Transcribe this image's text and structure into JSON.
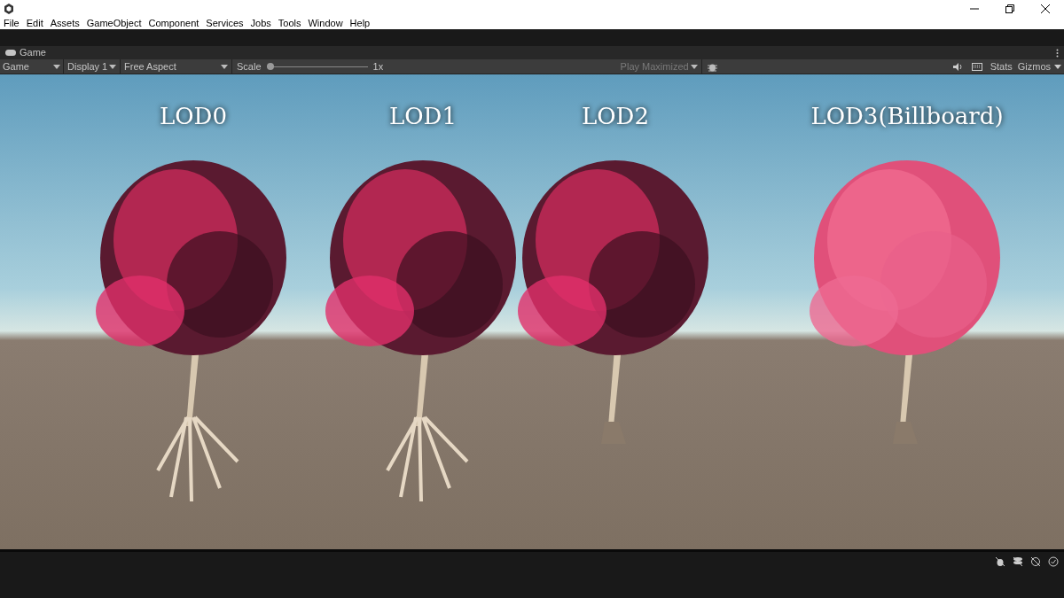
{
  "menu": [
    "File",
    "Edit",
    "Assets",
    "GameObject",
    "Component",
    "Services",
    "Jobs",
    "Tools",
    "Window",
    "Help"
  ],
  "tab": {
    "title": "Game"
  },
  "toolbar": {
    "view_dropdown": "Game",
    "display_dropdown": "Display 1",
    "aspect_dropdown": "Free Aspect",
    "scale_label": "Scale",
    "scale": {
      "level": 0.0
    },
    "scale_reading": "1x",
    "play_dropdown": {
      "label": "Play Maximized",
      "disabled": true
    },
    "stats": "Stats",
    "gizmos": "Gizmos"
  },
  "viewport": {
    "labels": [
      "LOD0",
      "LOD1",
      "LOD2",
      "LOD3(Billboard)"
    ]
  }
}
